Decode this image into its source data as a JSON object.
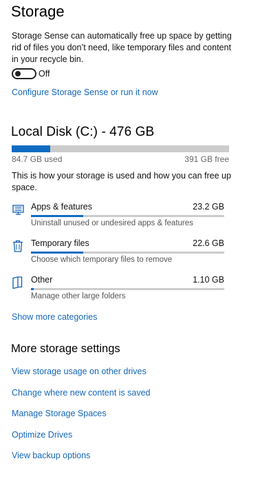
{
  "storage_sense": {
    "title": "Storage",
    "description": "Storage Sense can automatically free up space by getting rid of files you don’t need, like temporary files and content in your recycle bin.",
    "toggle_state": "Off",
    "configure_link": "Configure Storage Sense or run it now"
  },
  "disk": {
    "title": "Local Disk (C:) - 476 GB",
    "used_label": "84.7 GB used",
    "free_label": "391 GB free",
    "used_fraction": 0.178,
    "description": "This is how your storage is used and how you can free up space.",
    "categories": [
      {
        "icon": "apps-features-icon",
        "name": "Apps & features",
        "size": "23.2 GB",
        "fraction": 0.27,
        "description": "Uninstall unused or undesired apps & features"
      },
      {
        "icon": "trash-icon",
        "name": "Temporary files",
        "size": "22.6 GB",
        "fraction": 0.27,
        "description": "Choose which temporary files to remove"
      },
      {
        "icon": "folder-icon",
        "name": "Other",
        "size": "1.10 GB",
        "fraction": 0.013,
        "description": "Manage other large folders"
      }
    ],
    "show_more_link": "Show more categories"
  },
  "more_settings": {
    "title": "More storage settings",
    "links": [
      "View storage usage on other drives",
      "Change where new content is saved",
      "Manage Storage Spaces",
      "Optimize Drives",
      "View backup options"
    ]
  },
  "colors": {
    "accent": "#0f6cc2",
    "link": "#1467b9",
    "track": "#cccccc"
  }
}
